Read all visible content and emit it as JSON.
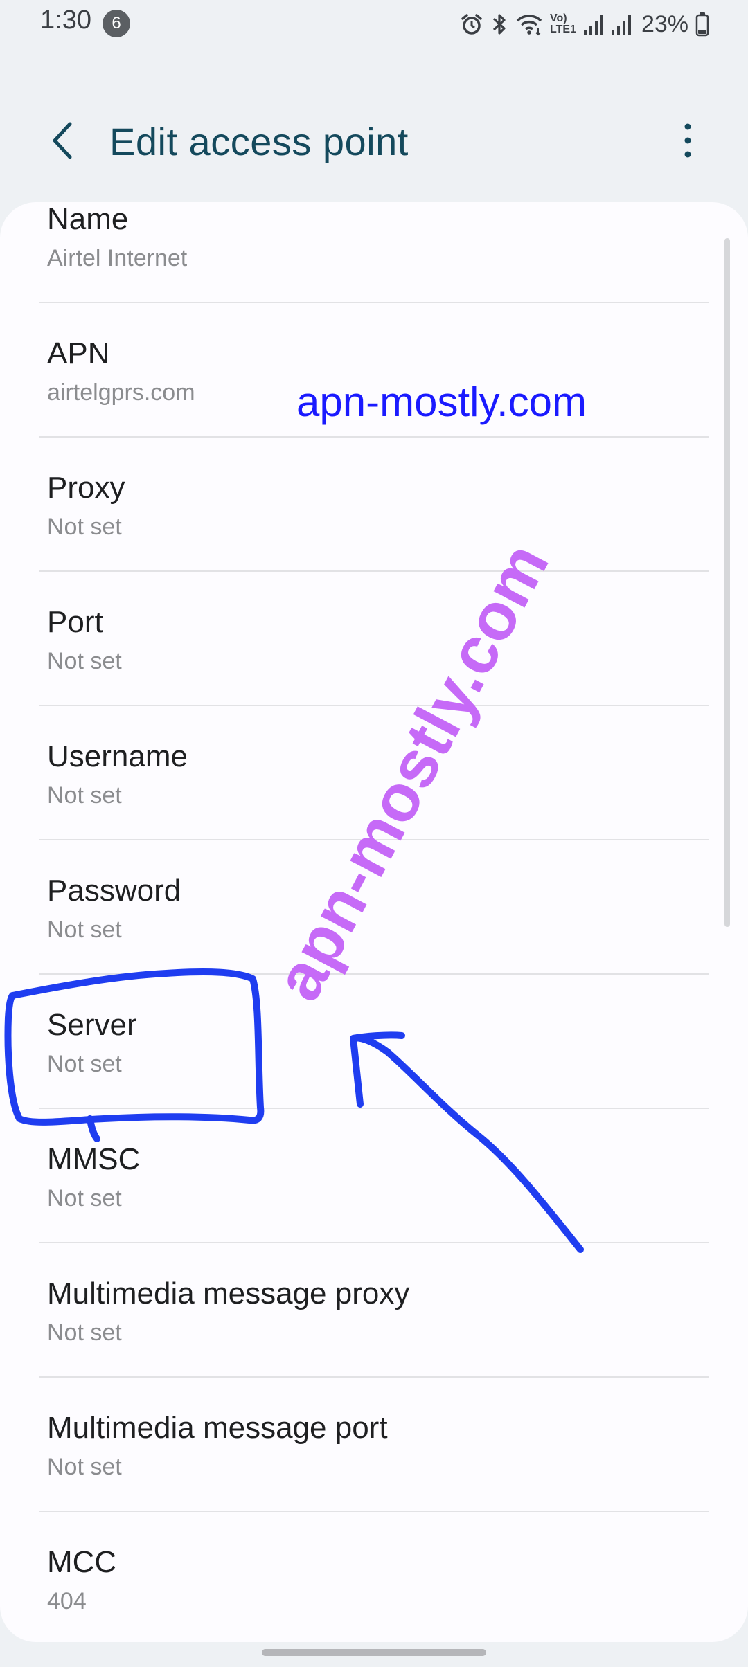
{
  "status_bar": {
    "time": "1:30",
    "notification_count": "6",
    "battery": "23%",
    "icons": [
      "alarm-icon",
      "bluetooth-icon",
      "wifi-icon",
      "volte-icon",
      "signal-icon",
      "signal-icon",
      "battery-icon"
    ],
    "volte_line1": "Vo)",
    "volte_line2": "LTE1"
  },
  "header": {
    "title": "Edit access point",
    "back_icon": "back-arrow-icon",
    "menu_icon": "more-vertical-icon"
  },
  "settings": [
    {
      "label": "Name",
      "value": "Airtel Internet"
    },
    {
      "label": "APN",
      "value": "airtelgprs.com"
    },
    {
      "label": "Proxy",
      "value": "Not set"
    },
    {
      "label": "Port",
      "value": "Not set"
    },
    {
      "label": "Username",
      "value": "Not set"
    },
    {
      "label": "Password",
      "value": "Not set"
    },
    {
      "label": "Server",
      "value": "Not set"
    },
    {
      "label": "MMSC",
      "value": "Not set"
    },
    {
      "label": "Multimedia message proxy",
      "value": "Not set"
    },
    {
      "label": "Multimedia message port",
      "value": "Not set"
    },
    {
      "label": "MCC",
      "value": "404"
    }
  ],
  "watermarks": {
    "horizontal": "apn-mostly.com",
    "diagonal": "apn-mostly.com"
  },
  "colors": {
    "title": "#14495c",
    "annotation_blue": "#1f3df0",
    "watermark_blue": "#1a1aff",
    "watermark_purple": "#c66af7"
  }
}
